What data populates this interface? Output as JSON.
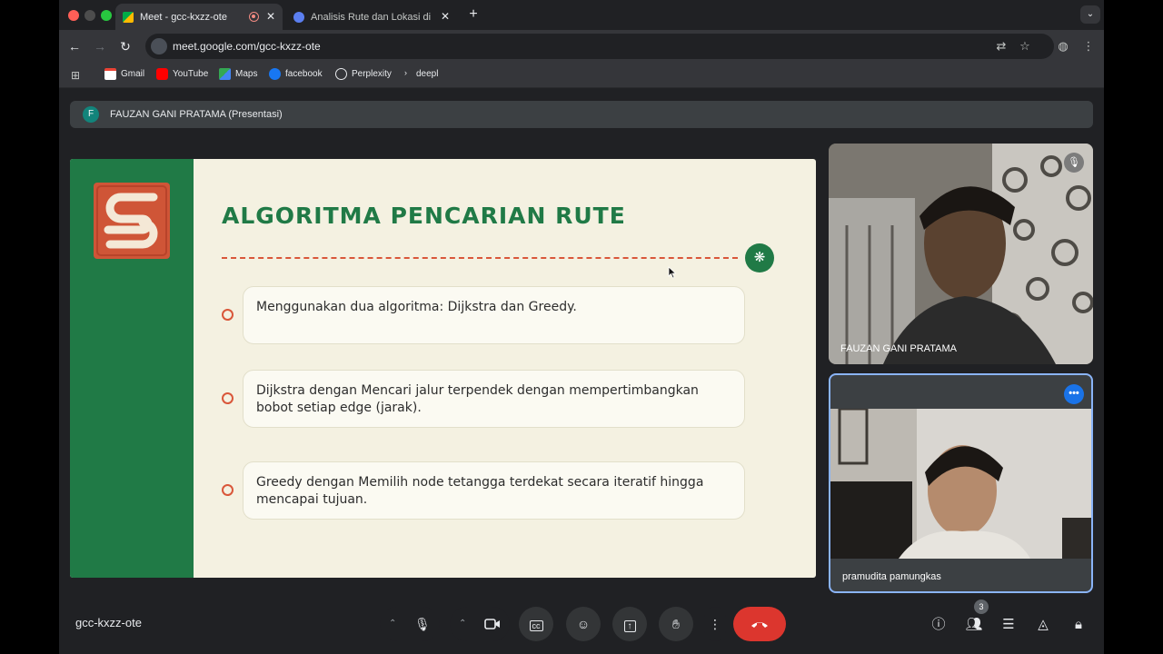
{
  "browser": {
    "tabs": [
      {
        "title": "Meet - gcc-kxzz-ote",
        "active": true
      },
      {
        "title": "Analisis Rute dan Lokasi di Ke",
        "active": false
      }
    ],
    "new_tab_label": "+",
    "url": "meet.google.com/gcc-kxzz-ote",
    "bookmarks": [
      "Gmail",
      "YouTube",
      "Maps",
      "facebook",
      "Perplexity",
      "deepl"
    ],
    "colors": {
      "tab_active": "#35363a",
      "toolbar": "#35363a",
      "frame": "#202124"
    }
  },
  "meet": {
    "presenter_initial": "F",
    "presenter_banner": "FAUZAN GANI PRATAMA (Presentasi)",
    "meeting_code": "gcc-kxzz-ote",
    "participant_count": "3",
    "participants": [
      {
        "name": "FAUZAN GANI PRATAMA",
        "muted": true
      },
      {
        "name": "pramudita pamungkas",
        "muted": false
      }
    ],
    "controls": [
      "microphone-icon",
      "camera-icon",
      "captions-icon",
      "emoji-icon",
      "present-icon",
      "raise-hand-icon",
      "more-options-icon",
      "end-call-icon"
    ],
    "right_controls": [
      "info-icon",
      "people-icon",
      "chat-icon",
      "activities-icon",
      "host-controls-icon"
    ],
    "colors": {
      "end_call": "#dc362e",
      "active_speaker_border": "#8ab4f8",
      "accent": "#1a73e8"
    }
  },
  "slide": {
    "title": "ALGORITMA PENCARIAN RUTE",
    "bullets": [
      "Menggunakan dua algoritma: Dijkstra dan Greedy.",
      "Dijkstra dengan Mencari jalur terpendek dengan mempertimbangkan bobot setiap edge (jarak).",
      "Greedy dengan Memilih node tetangga terdekat secara iteratif hingga mencapai tujuan."
    ],
    "colors": {
      "background": "#f4f1e1",
      "sidebar": "#207a46",
      "accent": "#d9573a",
      "title": "#207a46"
    }
  }
}
